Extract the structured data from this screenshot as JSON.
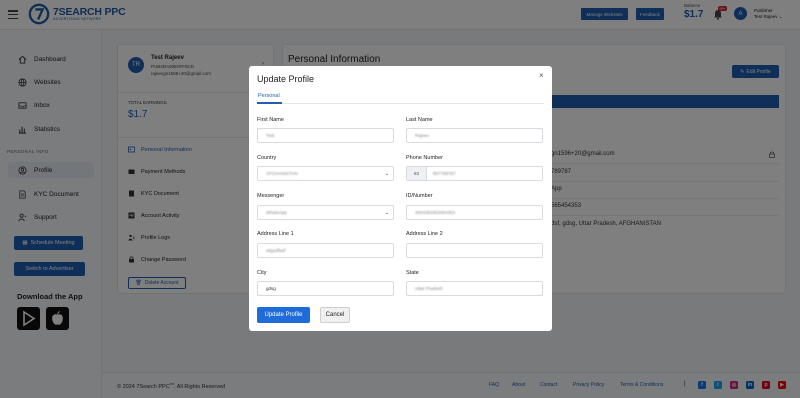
{
  "header": {
    "logo_name": "7SEARCH PPC",
    "logo_sub": "ADVERTISING NETWORK",
    "manage_websites": "Manage Websites",
    "feedback": "Feedback",
    "balance_label": "Balance",
    "balance_value": "$1.7",
    "notif_count": "99+",
    "avatar_letter": "A",
    "user_role": "Publisher",
    "user_name": "Test Rajeev"
  },
  "sidebar": {
    "items": [
      {
        "label": "Dashboard",
        "icon": "home-icon"
      },
      {
        "label": "Websites",
        "icon": "globe-icon"
      },
      {
        "label": "Inbox",
        "icon": "inbox-icon"
      },
      {
        "label": "Statistics",
        "icon": "bar-chart-icon"
      }
    ],
    "section_label": "PERSONAL INFO",
    "personal_items": [
      {
        "label": "Profile",
        "icon": "user-icon"
      },
      {
        "label": "KYC Document",
        "icon": "document-icon"
      },
      {
        "label": "Support",
        "icon": "support-icon"
      }
    ],
    "schedule_meeting": "Schedule Meeting",
    "switch_advertiser": "Switch to Advertiser",
    "download_title": "Download the App"
  },
  "profile_card": {
    "initials": "TR",
    "name": "Test Rajeev",
    "id": "PUB4DA00E0FF0CD",
    "email": "rajeevgn1596+20@gmail.com",
    "total_label": "TOTAL EARNINGS",
    "total_value": "$1.7",
    "menu": [
      {
        "label": "Personal Information",
        "icon": "id-card-icon"
      },
      {
        "label": "Payment Methods",
        "icon": "wallet-icon"
      },
      {
        "label": "KYC Document",
        "icon": "document-icon"
      },
      {
        "label": "Account Activity",
        "icon": "activity-icon"
      },
      {
        "label": "Profile Logs",
        "icon": "logs-icon"
      },
      {
        "label": "Change Password",
        "icon": "lock-icon"
      }
    ],
    "delete_account": "Delete Account"
  },
  "info": {
    "title": "Personal Information",
    "edit_label": "Edit Profile",
    "rows": [
      "gn1596+20@gmail.com",
      "789787",
      "App",
      "565454353",
      "dsf, gdsg, Uttar Pradesh, AFGHANISTAN"
    ]
  },
  "footer": {
    "copyright": "© 2024 7Search PPC",
    "tm": "TM",
    "rights": ". All Rights Reserved",
    "links": [
      "FAQ",
      "About",
      "Contact",
      "Privacy Policy",
      "Terms & Conditions"
    ],
    "separator": "|",
    "social": [
      {
        "name": "facebook-icon",
        "glyph": "f",
        "color": "#1877f2"
      },
      {
        "name": "twitter-icon",
        "glyph": "t",
        "color": "#1da1f2"
      },
      {
        "name": "instagram-icon",
        "glyph": "◎",
        "color": "#d62976"
      },
      {
        "name": "linkedin-icon",
        "glyph": "in",
        "color": "#0a66c2"
      },
      {
        "name": "pinterest-icon",
        "glyph": "p",
        "color": "#e60023"
      },
      {
        "name": "youtube-icon",
        "glyph": "▶",
        "color": "#ff0000"
      }
    ]
  },
  "modal": {
    "title": "Update Profile",
    "close": "×",
    "tab": "Personal",
    "fields": {
      "first_name": {
        "label": "First Name",
        "value": "Test"
      },
      "last_name": {
        "label": "Last Name",
        "value": "Rajeev"
      },
      "country": {
        "label": "Country",
        "value": "AFGHANISTAN"
      },
      "phone": {
        "label": "Phone Number",
        "prefix": "93",
        "value": "897789787"
      },
      "messenger": {
        "label": "Messenger",
        "value": "WhatsApp"
      },
      "id_number": {
        "label": "ID/Number",
        "value": "4554353453454353"
      },
      "address1": {
        "label": "Address Line 1",
        "value": "sdgsdfsef"
      },
      "address2": {
        "label": "Address Line 2",
        "value": ""
      },
      "city": {
        "label": "City",
        "value": "gdsg"
      },
      "state": {
        "label": "State",
        "value": "Uttar Pradesh"
      }
    },
    "update_label": "Update Profile",
    "cancel_label": "Cancel"
  },
  "colors": {
    "primary": "#1f5fb3",
    "overlay": "rgba(0,0,0,0.5)"
  }
}
